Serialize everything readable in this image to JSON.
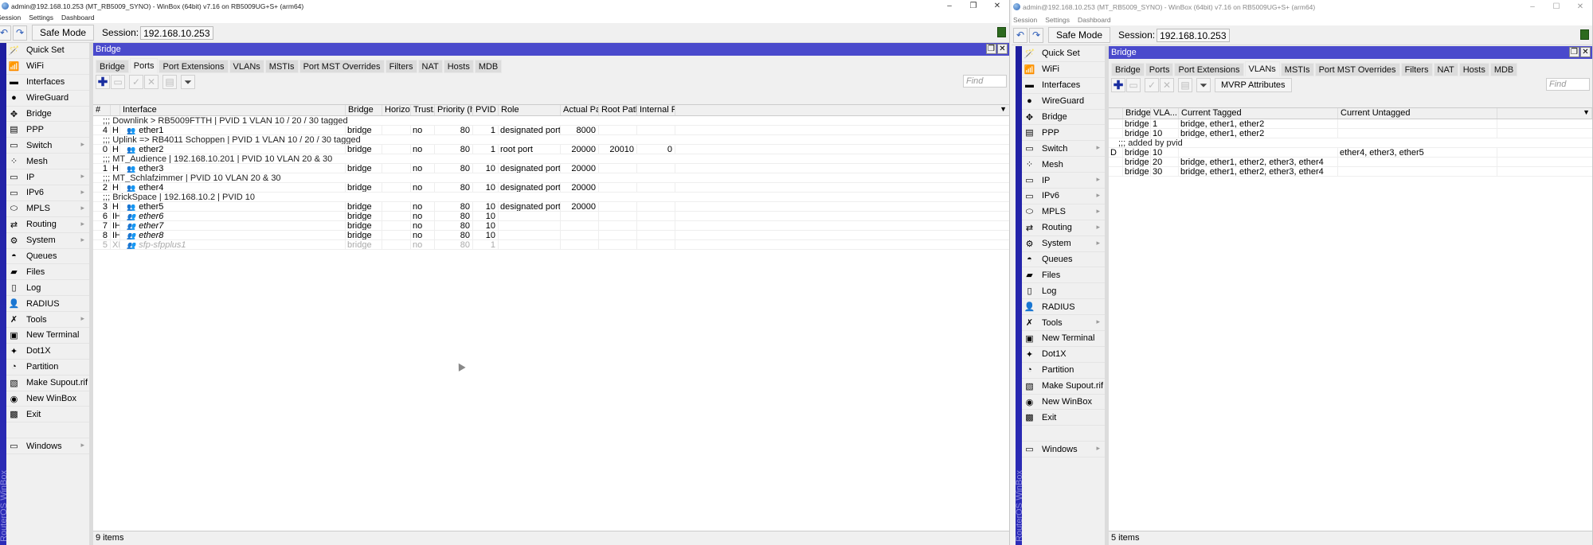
{
  "left": {
    "title": "admin@192.168.10.253 (MT_RB5009_SYNO) - WinBox (64bit) v7.16 on RB5009UG+S+ (arm64)",
    "window_controls": [
      "–",
      "❐",
      "✕"
    ],
    "menu": [
      "Session",
      "Settings",
      "Dashboard"
    ],
    "toolbar": {
      "safe_mode": "Safe Mode",
      "session_label": "Session:",
      "session_value": "192.168.10.253"
    },
    "ros_label": "RouterOS WinBox",
    "sidebar": [
      {
        "label": "Quick Set",
        "icon": "🪄",
        "arrow": false
      },
      {
        "label": "WiFi",
        "icon": "📶",
        "arrow": false
      },
      {
        "label": "Interfaces",
        "icon": "▬",
        "arrow": false
      },
      {
        "label": "WireGuard",
        "icon": "●",
        "arrow": false
      },
      {
        "label": "Bridge",
        "icon": "✥",
        "arrow": false
      },
      {
        "label": "PPP",
        "icon": "▤",
        "arrow": false
      },
      {
        "label": "Switch",
        "icon": "▭",
        "arrow": true
      },
      {
        "label": "Mesh",
        "icon": "⁘",
        "arrow": false
      },
      {
        "label": "IP",
        "icon": "▭",
        "arrow": true
      },
      {
        "label": "IPv6",
        "icon": "▭",
        "arrow": true
      },
      {
        "label": "MPLS",
        "icon": "⬭",
        "arrow": true
      },
      {
        "label": "Routing",
        "icon": "⇄",
        "arrow": true
      },
      {
        "label": "System",
        "icon": "⚙",
        "arrow": true
      },
      {
        "label": "Queues",
        "icon": "◓",
        "arrow": false
      },
      {
        "label": "Files",
        "icon": "▰",
        "arrow": false
      },
      {
        "label": "Log",
        "icon": "▯",
        "arrow": false
      },
      {
        "label": "RADIUS",
        "icon": "👤",
        "arrow": false
      },
      {
        "label": "Tools",
        "icon": "✗",
        "arrow": true
      },
      {
        "label": "New Terminal",
        "icon": "▣",
        "arrow": false
      },
      {
        "label": "Dot1X",
        "icon": "✦",
        "arrow": false
      },
      {
        "label": "Partition",
        "icon": "◔",
        "arrow": false
      },
      {
        "label": "Make Supout.rif",
        "icon": "▧",
        "arrow": false
      },
      {
        "label": "New WinBox",
        "icon": "◉",
        "arrow": false
      },
      {
        "label": "Exit",
        "icon": "▩",
        "arrow": false
      }
    ],
    "windows_item": {
      "label": "Windows",
      "icon": "▭"
    },
    "panel": {
      "title": "Bridge",
      "tabs": [
        "Bridge",
        "Ports",
        "Port Extensions",
        "VLANs",
        "MSTIs",
        "Port MST Overrides",
        "Filters",
        "NAT",
        "Hosts",
        "MDB"
      ],
      "active_tab": "Ports",
      "find_placeholder": "Find",
      "columns": [
        "#",
        "",
        "Interface",
        "Bridge",
        "Horizon",
        "Trust...",
        "Priority (hex)",
        "PVID",
        "Role",
        "Actual Pat...",
        "Root Path...",
        "Internal R..."
      ],
      "rows": [
        {
          "type": "comment",
          "text": ";;; Downlink > RB5009FTTH | PVID 1 VLAN 10 / 20 / 30 tagged"
        },
        {
          "type": "row",
          "num": "4",
          "flags": "H",
          "iface": "ether1",
          "bridge": "bridge",
          "horizon": "",
          "trust": "no",
          "prio": "80",
          "pvid": "1",
          "role": "designated port",
          "actual": "8000",
          "root": "",
          "internal": ""
        },
        {
          "type": "comment",
          "text": ";;; Uplink => RB4011 Schoppen | PVID 1 VLAN 10 / 20 / 30 tagged"
        },
        {
          "type": "row",
          "num": "0",
          "flags": "H",
          "iface": "ether2",
          "bridge": "bridge",
          "horizon": "",
          "trust": "no",
          "prio": "80",
          "pvid": "1",
          "role": "root port",
          "actual": "20000",
          "root": "20010",
          "internal": "0"
        },
        {
          "type": "comment",
          "text": ";;; MT_Audience | 192.168.10.201 | PVID 10 VLAN 20 & 30"
        },
        {
          "type": "row",
          "num": "1",
          "flags": "H",
          "iface": "ether3",
          "bridge": "bridge",
          "horizon": "",
          "trust": "no",
          "prio": "80",
          "pvid": "10",
          "role": "designated port",
          "actual": "20000",
          "root": "",
          "internal": ""
        },
        {
          "type": "comment",
          "text": ";;; MT_Schlafzimmer | PVID 10 VLAN 20 & 30"
        },
        {
          "type": "row",
          "num": "2",
          "flags": "H",
          "iface": "ether4",
          "bridge": "bridge",
          "horizon": "",
          "trust": "no",
          "prio": "80",
          "pvid": "10",
          "role": "designated port",
          "actual": "20000",
          "root": "",
          "internal": ""
        },
        {
          "type": "comment",
          "text": ";;; BrickSpace | 192.168.10.2 | PVID 10"
        },
        {
          "type": "row",
          "num": "3",
          "flags": "H",
          "iface": "ether5",
          "bridge": "bridge",
          "horizon": "",
          "trust": "no",
          "prio": "80",
          "pvid": "10",
          "role": "designated port",
          "actual": "20000",
          "root": "",
          "internal": ""
        },
        {
          "type": "row",
          "style": "italic",
          "num": "6",
          "flags": "IH",
          "iface": "ether6",
          "bridge": "bridge",
          "horizon": "",
          "trust": "no",
          "prio": "80",
          "pvid": "10",
          "role": "",
          "actual": "",
          "root": "",
          "internal": ""
        },
        {
          "type": "row",
          "style": "italic",
          "num": "7",
          "flags": "IH",
          "iface": "ether7",
          "bridge": "bridge",
          "horizon": "",
          "trust": "no",
          "prio": "80",
          "pvid": "10",
          "role": "",
          "actual": "",
          "root": "",
          "internal": ""
        },
        {
          "type": "row",
          "style": "italic",
          "num": "8",
          "flags": "IH",
          "iface": "ether8",
          "bridge": "bridge",
          "horizon": "",
          "trust": "no",
          "prio": "80",
          "pvid": "10",
          "role": "",
          "actual": "",
          "root": "",
          "internal": ""
        },
        {
          "type": "row",
          "style": "disabled",
          "num": "5",
          "flags": "XI",
          "iface": "sfp-sfpplus1",
          "bridge": "bridge",
          "horizon": "",
          "trust": "no",
          "prio": "80",
          "pvid": "1",
          "role": "",
          "actual": "",
          "root": "",
          "internal": ""
        }
      ],
      "status": "9 items"
    }
  },
  "right": {
    "title": "admin@192.168.10.253 (MT_RB5009_SYNO) - WinBox (64bit) v7.16 on RB5009UG+S+ (arm64)",
    "window_controls": [
      "–",
      "☐",
      "✕"
    ],
    "menu": [
      "Session",
      "Settings",
      "Dashboard"
    ],
    "toolbar": {
      "safe_mode": "Safe Mode",
      "session_label": "Session:",
      "session_value": "192.168.10.253"
    },
    "ros_label": "RouterOS WinBox",
    "panel": {
      "title": "Bridge",
      "tabs": [
        "Bridge",
        "Ports",
        "Port Extensions",
        "VLANs",
        "MSTIs",
        "Port MST Overrides",
        "Filters",
        "NAT",
        "Hosts",
        "MDB"
      ],
      "active_tab": "VLANs",
      "mvrp_button": "MVRP Attributes",
      "find_placeholder": "Find",
      "columns": [
        "",
        "Bridge",
        "VLA...",
        "Current Tagged",
        "Current Untagged",
        ""
      ],
      "rows": [
        {
          "type": "row",
          "flag": "",
          "bridge": "bridge",
          "vlan": "1",
          "tagged": "bridge, ether1, ether2",
          "untagged": ""
        },
        {
          "type": "row",
          "flag": "",
          "bridge": "bridge",
          "vlan": "10",
          "tagged": "bridge, ether1, ether2",
          "untagged": ""
        },
        {
          "type": "comment",
          "text": ";;; added by pvid"
        },
        {
          "type": "row",
          "flag": "D",
          "bridge": "bridge",
          "vlan": "10",
          "tagged": "",
          "untagged": "ether4, ether3, ether5"
        },
        {
          "type": "row",
          "flag": "",
          "bridge": "bridge",
          "vlan": "20",
          "tagged": "bridge, ether1, ether2, ether3, ether4",
          "untagged": ""
        },
        {
          "type": "row",
          "flag": "",
          "bridge": "bridge",
          "vlan": "30",
          "tagged": "bridge, ether1, ether2, ether3, ether4",
          "untagged": ""
        }
      ],
      "status": "5 items"
    }
  }
}
